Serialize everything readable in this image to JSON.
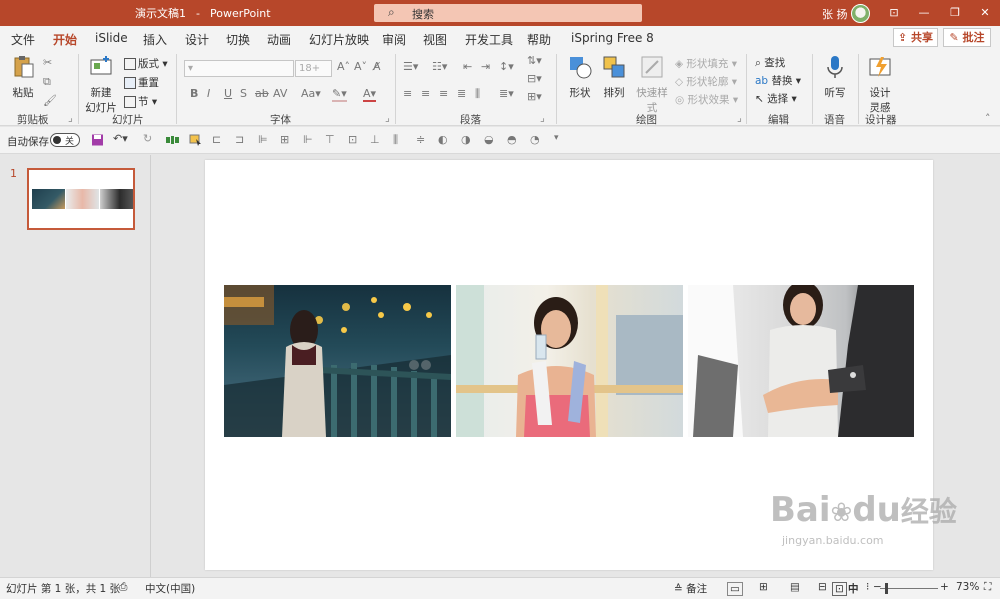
{
  "titlebar": {
    "doc_name": "演示文稿1",
    "separator": "-",
    "app_name": "PowerPoint",
    "search_placeholder": "搜索",
    "user_name": "张 扬"
  },
  "tabs": [
    "文件",
    "开始",
    "iSlide",
    "插入",
    "设计",
    "切换",
    "动画",
    "幻灯片放映",
    "审阅",
    "视图",
    "开发工具",
    "帮助",
    "iSpring Free 8"
  ],
  "active_tab": "开始",
  "share_label": "共享",
  "comment_label": "批注",
  "ribbon": {
    "clipboard": {
      "paste": "粘贴",
      "label": "剪贴板"
    },
    "slides": {
      "new_slide_1": "新建",
      "new_slide_2": "幻灯片",
      "layout": "版式",
      "reset": "重置",
      "section": "节",
      "label": "幻灯片"
    },
    "font": {
      "font_size": "18+",
      "label": "字体"
    },
    "paragraph": {
      "label": "段落"
    },
    "drawing": {
      "shapes": "形状",
      "arrange": "排列",
      "quick_styles": "快速样式",
      "fill": "形状填充",
      "outline": "形状轮廓",
      "effects": "形状效果",
      "label": "绘图"
    },
    "editing": {
      "find": "查找",
      "replace": "替换",
      "select": "选择",
      "label": "编辑"
    },
    "voice": {
      "dictate": "听写",
      "label": "语音"
    },
    "designer": {
      "ideas_1": "设计",
      "ideas_2": "灵感",
      "label": "设计器"
    }
  },
  "qat": {
    "autosave": "自动保存",
    "toggle_state": "关"
  },
  "slides_pane": {
    "slide_number": "1"
  },
  "status": {
    "slide_info": "幻灯片 第 1 张，共 1 张",
    "language": "中文(中国)",
    "notes": "备注",
    "ime": "中",
    "zoom": "73%"
  },
  "watermark": {
    "brand": "Bai",
    "brand_cn": "经验",
    "url": "jingyan.baidu.com"
  }
}
